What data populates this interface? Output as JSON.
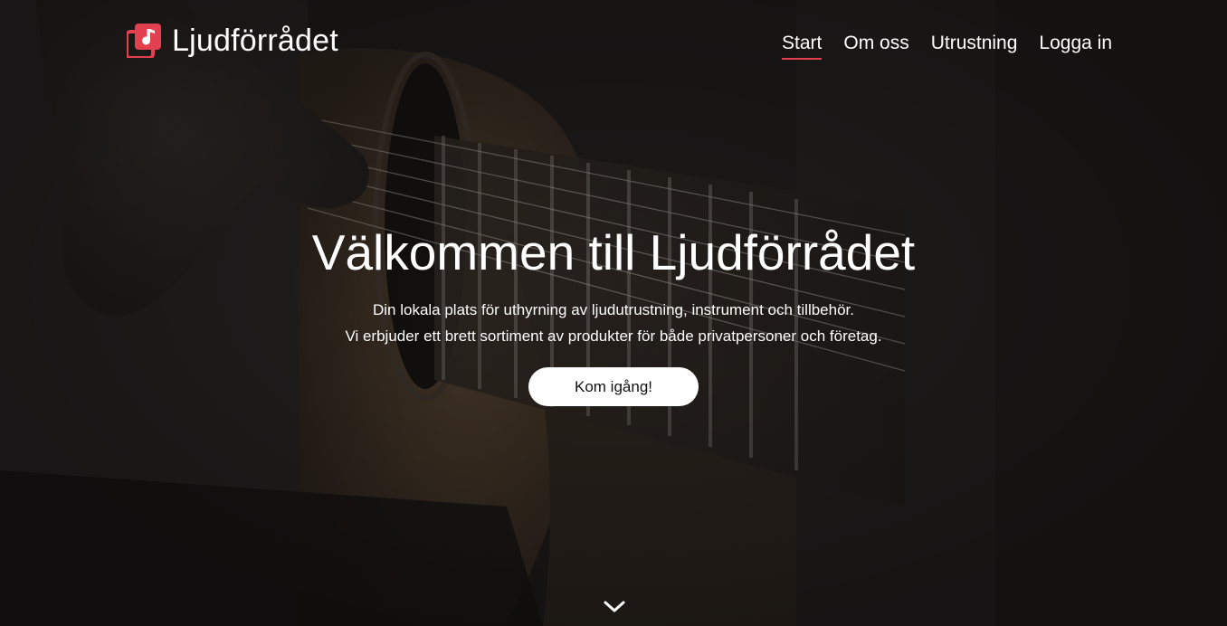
{
  "brand": {
    "name": "Ljudförrådet",
    "logo_icon": "music-note-stack-icon",
    "accent_color": "#e2404e"
  },
  "nav": {
    "items": [
      {
        "label": "Start",
        "active": true
      },
      {
        "label": "Om oss",
        "active": false
      },
      {
        "label": "Utrustning",
        "active": false
      },
      {
        "label": "Logga in",
        "active": false
      }
    ]
  },
  "hero": {
    "title": "Välkommen till Ljudförrådet",
    "lead_line_1": "Din lokala plats för uthyrning av ljudutrustning, instrument och tillbehör.",
    "lead_line_2": "Vi erbjuder ett brett sortiment av produkter för både privatpersoner och företag.",
    "cta_label": "Kom igång!",
    "scroll_icon": "chevron-down-icon",
    "background": "guitar-player-photo"
  }
}
